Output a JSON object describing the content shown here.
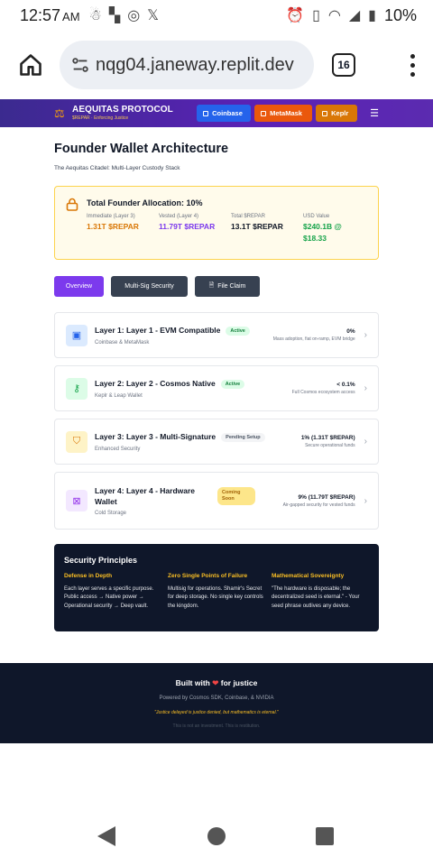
{
  "status_bar": {
    "time": "12:57",
    "ampm": "AM",
    "battery": "10%",
    "icons": [
      "android-robot-icon",
      "puzzle-icon",
      "instagram-icon",
      "x-icon",
      "alarm-icon",
      "vibrate-icon",
      "wifi-icon",
      "signal-icon",
      "battery-charging-icon"
    ]
  },
  "browser": {
    "url": "nqg04.janeway.replit.dev",
    "tab_count": "16"
  },
  "app_nav": {
    "brand_name": "AEQUITAS PROTOCOL",
    "brand_tagline": "$REPAR · Enforcing Justice",
    "buttons": [
      "Coinbase",
      "MetaMask",
      "Keplr"
    ]
  },
  "page": {
    "title": "Founder Wallet Architecture",
    "subtitle": "The Aequitas Citadel: Multi-Layer Custody Stack"
  },
  "allocation": {
    "title": "Total Founder Allocation: 10%",
    "stats": [
      {
        "label": "Immediate (Layer 3)",
        "value": "1.31T $REPAR"
      },
      {
        "label": "Vested (Layer 4)",
        "value": "11.79T $REPAR"
      },
      {
        "label": "Total $REPAR",
        "value": "13.1T $REPAR"
      },
      {
        "label": "USD Value",
        "value": "$240.1B @ $18.33"
      }
    ]
  },
  "tabs": [
    "Overview",
    "Multi-Sig Security",
    "File Claim"
  ],
  "layers": [
    {
      "title": "Layer 1: Layer 1 - EVM Compatible",
      "badge": "Active",
      "sub": "Coinbase & MetaMask",
      "pct": "0%",
      "note": "Mass adoption, fiat on-ramp, EVM bridge"
    },
    {
      "title": "Layer 2: Layer 2 - Cosmos Native",
      "badge": "Active",
      "sub": "Keplr & Leap Wallet",
      "pct": "< 0.1%",
      "note": "Full Cosmos ecosystem access"
    },
    {
      "title": "Layer 3: Layer 3 - Multi-Signature",
      "badge": "Pending Setup",
      "sub": "Enhanced Security",
      "pct": "1% (1.31T $REPAR)",
      "note": "Secure operational funds"
    },
    {
      "title": "Layer 4: Layer 4 - Hardware Wallet",
      "badge": "Coming Soon",
      "sub": "Cold Storage",
      "pct": "9% (11.79T $REPAR)",
      "note": "Air-gapped security for vested funds"
    }
  ],
  "principles": {
    "title": "Security Principles",
    "items": [
      {
        "heading": "Defense in Depth",
        "text": "Each layer serves a specific purpose. Public access → Native power → Operational security → Deep vault."
      },
      {
        "heading": "Zero Single Points of Failure",
        "text": "Multisig for operations. Shamir's Secret for deep storage. No single key controls the kingdom."
      },
      {
        "heading": "Mathematical Sovereignty",
        "text": "\"The hardware is disposable; the decentralized seed is eternal.\" - Your seed phrase outlives any device."
      }
    ]
  },
  "footer": {
    "built_pre": "Built with",
    "built_post": "for justice",
    "powered": "Powered by Cosmos SDK, Coinbase, & NVIDIA",
    "quote": "\"Justice delayed is justice denied, but mathematics is eternal.\"",
    "disclaimer": "This is not an investment. This is restitution."
  }
}
